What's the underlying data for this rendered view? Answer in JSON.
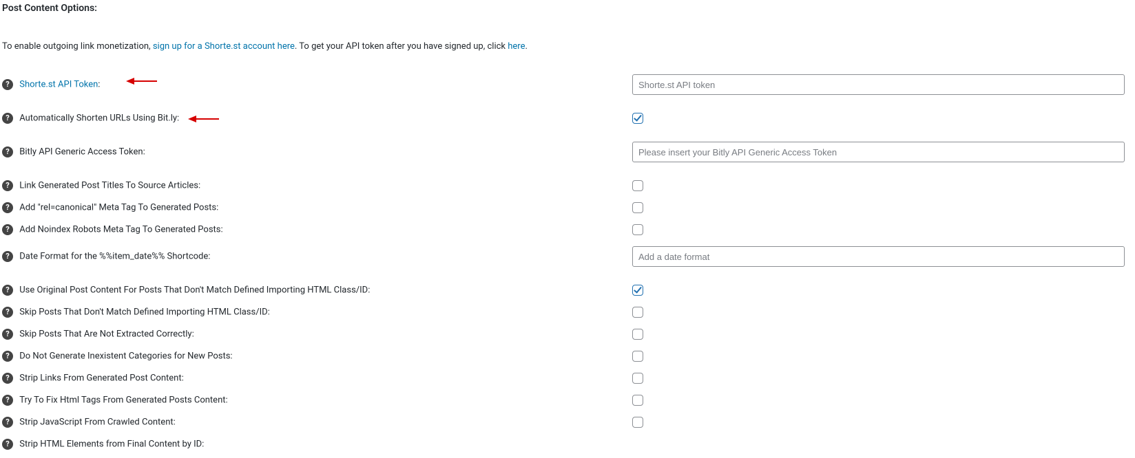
{
  "section": {
    "title": "Post Content Options:"
  },
  "intro": {
    "before": "To enable outgoing link monetization, ",
    "link1": "sign up for a Shorte.st account here",
    "mid": ". To get your API token after you have signed up, click ",
    "link2": "here",
    "after": "."
  },
  "rows": {
    "shortest_api": {
      "label": "Shorte.st API Token",
      "placeholder": "Shorte.st API token"
    },
    "bitly_auto": {
      "label": "Automatically Shorten URLs Using Bit.ly:"
    },
    "bitly_token": {
      "label": "Bitly API Generic Access Token:",
      "placeholder": "Please insert your Bitly API Generic Access Token"
    },
    "link_titles": {
      "label": "Link Generated Post Titles To Source Articles:"
    },
    "canonical": {
      "label": "Add \"rel=canonical\" Meta Tag To Generated Posts:"
    },
    "noindex": {
      "label": "Add Noindex Robots Meta Tag To Generated Posts:"
    },
    "date_format": {
      "label": "Date Format for the %%item_date%% Shortcode:",
      "placeholder": "Add a date format"
    },
    "use_original": {
      "label": "Use Original Post Content For Posts That Don't Match Defined Importing HTML Class/ID:"
    },
    "skip_nomatch": {
      "label": "Skip Posts That Don't Match Defined Importing HTML Class/ID:"
    },
    "skip_notextract": {
      "label": "Skip Posts That Are Not Extracted Correctly:"
    },
    "no_inexistent_cats": {
      "label": "Do Not Generate Inexistent Categories for New Posts:"
    },
    "strip_links": {
      "label": "Strip Links From Generated Post Content:"
    },
    "fix_html": {
      "label": "Try To Fix Html Tags From Generated Posts Content:"
    },
    "strip_js": {
      "label": "Strip JavaScript From Crawled Content:"
    },
    "strip_html_id": {
      "label": "Strip HTML Elements from Final Content by ID:"
    }
  },
  "checked": {
    "bitly_auto": true,
    "use_original": true
  }
}
